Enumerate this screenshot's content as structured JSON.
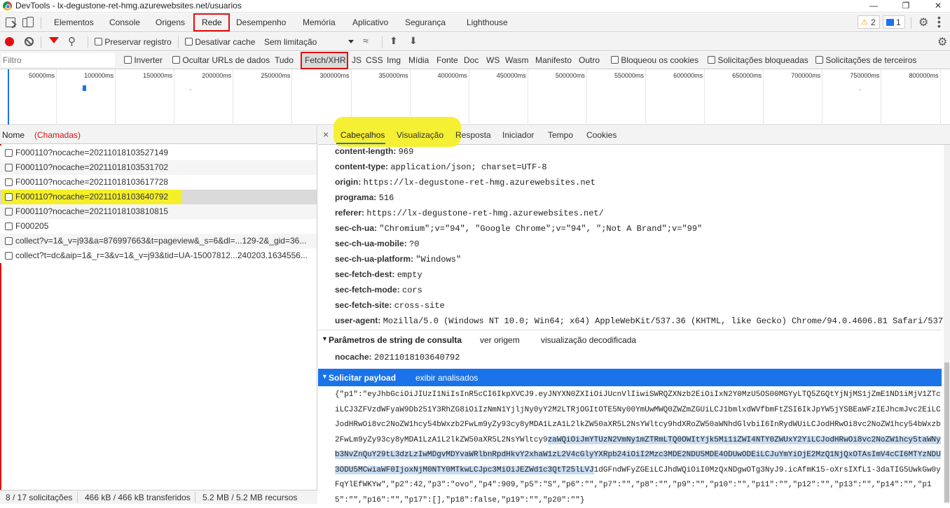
{
  "window": {
    "title": "DevTools - lx-degustone-ret-hmg.azurewebsites.net/usuarios"
  },
  "tabs": [
    "Elementos",
    "Console",
    "Origens",
    "Rede",
    "Desempenho",
    "Memória",
    "Aplicativo",
    "Segurança",
    "Lighthouse"
  ],
  "badges": {
    "warnings": "2",
    "messages": "1"
  },
  "network_toolbar": {
    "preserve_log": "Preservar registro",
    "disable_cache": "Desativar cache",
    "throttling": "Sem limitação"
  },
  "filter_bar": {
    "placeholder": "Filtro",
    "invert": "Inverter",
    "hide_data_urls": "Ocultar URLs de dados",
    "types": [
      "Tudo",
      "Fetch/XHR",
      "JS",
      "CSS",
      "Img",
      "Mídia",
      "Fonte",
      "Doc",
      "WS",
      "Wasm",
      "Manifesto",
      "Outro"
    ],
    "blocked_cookies": "Bloqueou os cookies",
    "blocked_requests": "Solicitações bloqueadas",
    "third_party": "Solicitações de terceiros"
  },
  "timeline": {
    "ticks": [
      "50000ms",
      "100000ms",
      "150000ms",
      "200000ms",
      "250000ms",
      "300000ms",
      "350000ms",
      "400000ms",
      "450000ms",
      "500000ms",
      "550000ms",
      "600000ms",
      "650000ms",
      "700000ms",
      "750000ms",
      "800000ms"
    ]
  },
  "request_list": {
    "header_name": "Nome",
    "header_note": "(Chamadas)",
    "items": [
      "F000110?nocache=20211018103527149",
      "F000110?nocache=20211018103531702",
      "F000110?nocache=20211018103617728",
      "F000110?nocache=20211018103640792",
      "F000110?nocache=20211018103810815",
      "F000205",
      "collect?v=1&_v=j93&a=876997663&t=pageview&_s=6&dl=...129-2&_gid=36...",
      "collect?t=dc&aip=1&_r=3&v=1&_v=j93&tid=UA-15007812...240203.1634556..."
    ]
  },
  "status": {
    "requests": "8 / 17 solicitações",
    "transferred": "466 kB / 466 kB transferidos",
    "resources": "5.2 MB / 5.2 MB recursos"
  },
  "detail_tabs": [
    "Cabeçalhos",
    "Visualização",
    "Resposta",
    "Iniciador",
    "Tempo",
    "Cookies"
  ],
  "headers": [
    {
      "k": "content-length:",
      "v": "969"
    },
    {
      "k": "content-type:",
      "v": "application/json; charset=UTF-8"
    },
    {
      "k": "origin:",
      "v": "https://lx-degustone-ret-hmg.azurewebsites.net"
    },
    {
      "k": "programa:",
      "v": "516"
    },
    {
      "k": "referer:",
      "v": "https://lx-degustone-ret-hmg.azurewebsites.net/"
    },
    {
      "k": "sec-ch-ua:",
      "v": "\"Chromium\";v=\"94\", \"Google Chrome\";v=\"94\", \";Not A Brand\";v=\"99\""
    },
    {
      "k": "sec-ch-ua-mobile:",
      "v": "?0"
    },
    {
      "k": "sec-ch-ua-platform:",
      "v": "\"Windows\""
    },
    {
      "k": "sec-fetch-dest:",
      "v": "empty"
    },
    {
      "k": "sec-fetch-mode:",
      "v": "cors"
    },
    {
      "k": "sec-fetch-site:",
      "v": "cross-site"
    },
    {
      "k": "user-agent:",
      "v": "Mozilla/5.0 (Windows NT 10.0; Win64; x64) AppleWebKit/537.36 (KHTML, like Gecko) Chrome/94.0.4606.81 Safari/537.36"
    }
  ],
  "query_section": {
    "title": "Parâmetros de string de consulta",
    "link1": "ver origem",
    "link2": "visualização decodificada",
    "param_key": "nocache:",
    "param_val": "20211018103640792"
  },
  "payload_section": {
    "title": "Solicitar payload",
    "link": "exibir analisados"
  },
  "payload_lines": [
    {
      "a": "{\"p1\":\"eyJhbGciOiJIUzI1NiIsInR5cCI6IkpXVCJ9.eyJNYXN0ZXIiOiJUcnVlIiwiSWRQZXNzb2EiOiIxN2Y0MzU5OS00MGYyLTQ5ZGQtYjNjMS1jZmE1ND1iMjV1ZTc",
      "s": "",
      "b": ""
    },
    {
      "a": "iLCJ3ZFVzdWFyaW9Db251Y3RhZG8iOiIzNmN1YjljNy0yY2M2LTRjOGItOTE5Ny00YmUwMWQ0ZWZmZGUiLCJ1bmlxdWVfbmFtZSI6IkJpYW5jYSBEaWFzIEJhcmJvc2EiLC",
      "s": "",
      "b": ""
    },
    {
      "a": "JodHRwOi8vc2NoZW1hcy54bWxzb2FwLm9yZy93cy8yMDA1LzA1L2lkZW50aXR5L2NsYWltcy9hdXRoZW50aWNhdGlvbiI6InRydWUiLCJodHRwOi8vc2NoZW1hcy54bWxzb",
      "s": "",
      "b": ""
    },
    {
      "a": "2FwLm9yZy93cy8yMDA1LzA1L2lkZW50aXR5L2NsYWltcy9",
      "s": "zaWQiOiJmYTUzN2VmNy1mZTRmLTQ0OWItYjk5Mi1iZWI4NTY0ZWUxY2YiLCJodHRwOi8vc2NoZW1hcy5taWNy",
      "b": ""
    },
    {
      "a": "",
      "s": "b3NvZnQuY29tL3dzLzIwMDgvMDYvaWRlbnRpdHkvY2xhaW1zL2V4cGlyYXRpb24iOiI2Mzc3MDE2NDU5MDE4ODUwODEiLCJuYmYiOjE2MzQ1NjQxOTAsImV4cCI6MTYzNDU",
      "b": ""
    },
    {
      "a": "",
      "s": "3ODU5MCwiaWF0IjoxNjM0NTY0MTkwLCJpc3MiOiJEZWd1c3QtT25lLVJ",
      "b": "1dGFndWFyZGEiLCJhdWQiOiI0MzQxNDgwOTg3NyJ9.icAfmK15-oXrsIXfL1-3daTIG5UwkGw0y"
    },
    {
      "a": "FqYlEfWKYw\",\"p2\":42,\"p3\":\"ovo\",\"p4\":909,\"p5\":\"S\",\"p6\":\"\",\"p7\":\"\",\"p8\":\"\",\"p9\":\"\",\"p10\":\"\",\"p11\":\"\",\"p12\":\"\",\"p13\":\"\",\"p14\":\"\",\"p1",
      "s": "",
      "b": ""
    },
    {
      "a": "5\":\"\",\"p16\":\"\",\"p17\":[],\"p18\":false,\"p19\":\"\",\"p20\":\"\"}",
      "s": "",
      "b": ""
    }
  ],
  "colors": {
    "accent": "#1a73e8",
    "highlight": "#f5ef2a",
    "annotation_red": "#e01010",
    "payload_header_bg": "#1a73e8"
  }
}
